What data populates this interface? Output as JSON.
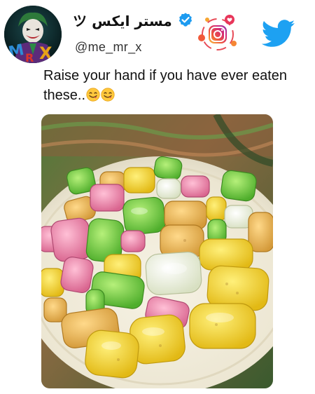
{
  "tweet": {
    "display_name": "مستر ايكس ツ",
    "handle": "@me_mr_x",
    "text": "Raise your hand if you have ever eaten these..",
    "emojis": [
      "smiling-face-savoring-food",
      "smiling-face-savoring-food"
    ],
    "verified": true,
    "avatar_label": "MRX"
  },
  "icons": {
    "instagram": "instagram-icon",
    "twitter": "twitter-bird-icon",
    "verified": "verified-badge-icon"
  },
  "colors": {
    "twitter_blue": "#1da1f2",
    "verified_blue": "#1d9bf0"
  }
}
